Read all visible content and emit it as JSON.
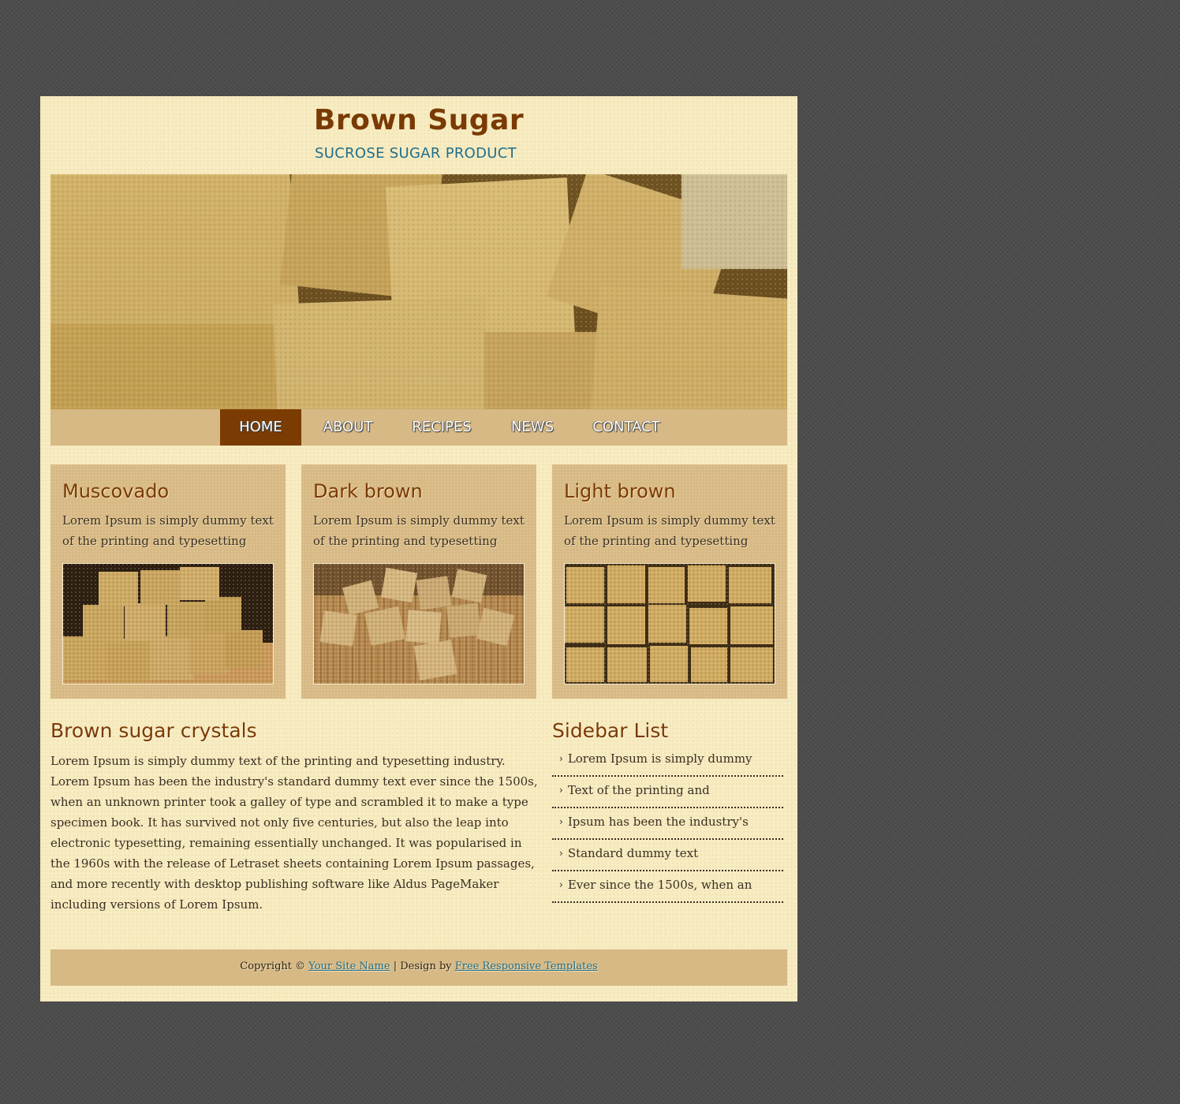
{
  "header": {
    "title": "Brown Sugar",
    "tagline": "SUCROSE SUGAR PRODUCT"
  },
  "nav": {
    "items": [
      {
        "label": "HOME",
        "active": true
      },
      {
        "label": "ABOUT",
        "active": false
      },
      {
        "label": "RECIPES",
        "active": false
      },
      {
        "label": "NEWS",
        "active": false
      },
      {
        "label": "CONTACT",
        "active": false
      }
    ]
  },
  "cards": [
    {
      "title": "Muscovado",
      "text": "Lorem Ipsum is simply dummy text of the printing and typesetting",
      "image": "stacked-sugar-cubes-photo"
    },
    {
      "title": "Dark brown",
      "text": "Lorem Ipsum is simply dummy text of the printing and typesetting",
      "image": "scattered-sugar-cubes-photo"
    },
    {
      "title": "Light brown",
      "text": "Lorem Ipsum is simply dummy text of the printing and typesetting",
      "image": "sugar-cube-rows-photo"
    }
  ],
  "main": {
    "title": "Brown sugar crystals",
    "text": "Lorem Ipsum is simply dummy text of the printing and typesetting industry. Lorem Ipsum has been the industry's standard dummy text ever since the 1500s, when an unknown printer took a galley of type and scrambled it to make a type specimen book. It has survived not only five centuries, but also the leap into electronic typesetting, remaining essentially unchanged. It was popularised in the 1960s with the release of Letraset sheets containing Lorem Ipsum passages, and more recently with desktop publishing software like Aldus PageMaker including versions of Lorem Ipsum."
  },
  "sidebar": {
    "title": "Sidebar List",
    "items": [
      "Lorem Ipsum is simply dummy",
      "Text of the printing and",
      "Ipsum has been the industry's",
      "Standard dummy text",
      "Ever since the 1500s, when an"
    ],
    "bullet_icon": "chevron-right-icon"
  },
  "footer": {
    "copyright": "Copyright ©",
    "site_link": "Your Site Name",
    "separator": "| Design by",
    "design_link": "Free Responsive Templates"
  },
  "colors": {
    "page_background": "#4b4b4b",
    "wrapper_background": "#f7ebc0",
    "accent_brown": "#7b3c04",
    "tagline_blue": "#1f6f8b",
    "panel_tan": "#d6b985",
    "link_blue": "#1c6d8c"
  }
}
